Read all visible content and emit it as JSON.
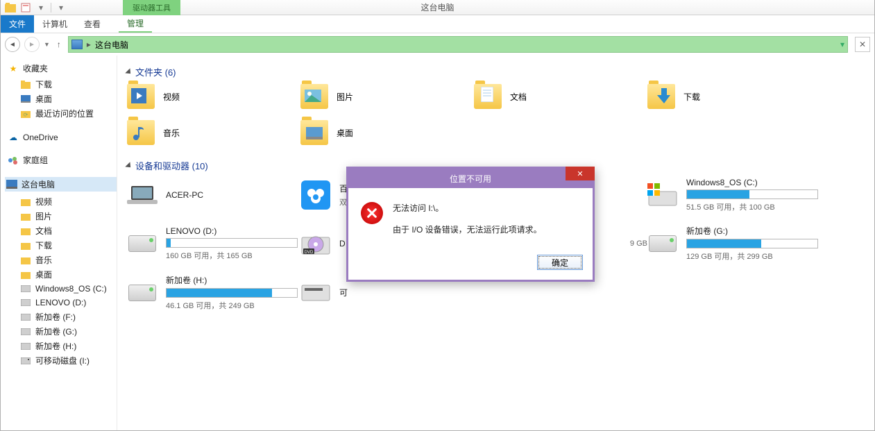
{
  "titlebar": {
    "drive_tools": "驱动器工具",
    "window_title": "这台电脑"
  },
  "ribbon": {
    "file": "文件",
    "computer": "计算机",
    "view": "查看",
    "manage": "管理"
  },
  "nav": {
    "location": "这台电脑"
  },
  "sidebar": {
    "favorites": {
      "label": "收藏夹",
      "items": [
        "下载",
        "桌面",
        "最近访问的位置"
      ]
    },
    "onedrive": "OneDrive",
    "homegroup": "家庭组",
    "this_pc": {
      "label": "这台电脑",
      "items": [
        "视频",
        "图片",
        "文档",
        "下载",
        "音乐",
        "桌面",
        "Windows8_OS (C:)",
        "LENOVO (D:)",
        "新加卷 (F:)",
        "新加卷 (G:)",
        "新加卷 (H:)",
        "可移动磁盘 (I:)"
      ]
    }
  },
  "section": {
    "folders": "文件夹 (6)",
    "devices": "设备和驱动器 (10)"
  },
  "folders": [
    "视频",
    "图片",
    "文档",
    "下载",
    "音乐",
    "桌面"
  ],
  "devices": {
    "acer": "ACER-PC",
    "baidu_partial": "百",
    "baidu_sub_partial": "双",
    "c": {
      "name": "Windows8_OS (C:)",
      "sub": "51.5 GB 可用，共 100 GB",
      "pct": 48
    },
    "d": {
      "name": "LENOVO (D:)",
      "sub": "160 GB 可用，共 165 GB",
      "pct": 3
    },
    "dvd_partial": "D",
    "g": {
      "name": "新加卷 (G:)",
      "sub": "129 GB 可用，共 299 GB",
      "pct": 57
    },
    "h": {
      "name": "新加卷 (H:)",
      "sub": "46.1 GB 可用，共 249 GB",
      "pct": 81
    },
    "removable_partial": "可",
    "hidden_sub": "9 GB"
  },
  "dialog": {
    "title": "位置不可用",
    "line1": "无法访问 I:\\。",
    "line2": "由于 I/O 设备错误，无法运行此项请求。",
    "ok": "确定"
  }
}
